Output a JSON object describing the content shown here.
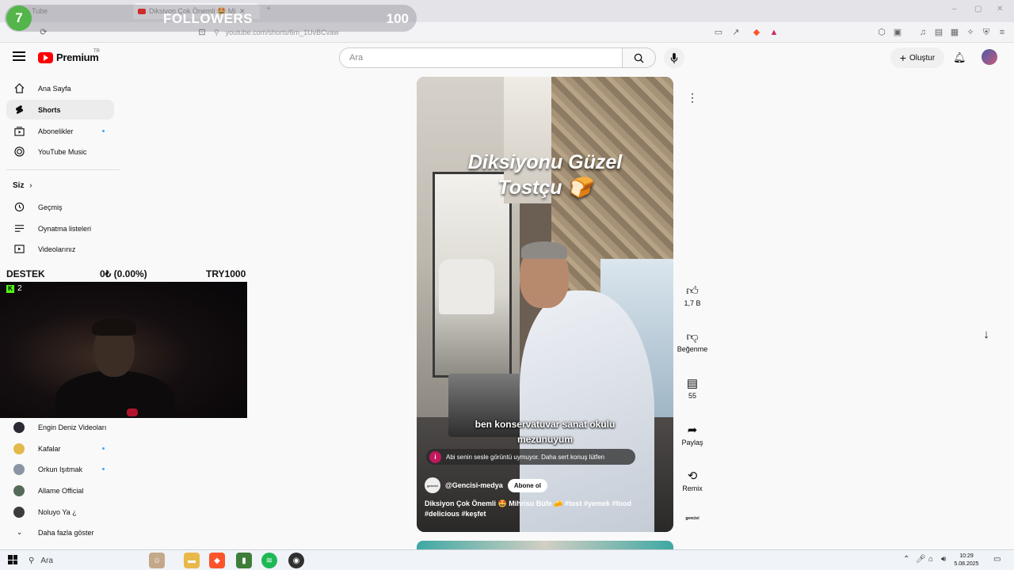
{
  "browser": {
    "tabs": [
      {
        "label": "Tube"
      },
      {
        "label": "Diksiyon Çok Önemli 🤩 Mihri"
      }
    ],
    "url": "youtube.com/shorts/6m_1UvBCvaw"
  },
  "overlay": {
    "follower_current": "7",
    "follower_label": "FOLLOWERS",
    "follower_goal": "100"
  },
  "header": {
    "brand": "Premium",
    "region": "TR",
    "search_placeholder": "Ara",
    "create_label": "Oluştur"
  },
  "sidebar": {
    "main": [
      {
        "label": "Ana Sayfa"
      },
      {
        "label": "Shorts"
      },
      {
        "label": "Abonelikler"
      },
      {
        "label": "YouTube Music"
      }
    ],
    "you_header": "Siz",
    "you": [
      {
        "label": "Geçmiş"
      },
      {
        "label": "Oynatma listeleri"
      },
      {
        "label": "Videolarınız"
      }
    ],
    "subscriptions": [
      {
        "label": "Engin Deniz Videoları"
      },
      {
        "label": "Kafalar"
      },
      {
        "label": "Orkun Işıtmak"
      },
      {
        "label": "Allame Official"
      },
      {
        "label": "Noluyo Ya ¿"
      }
    ],
    "show_more": "Daha fazla göster"
  },
  "donation": {
    "label": "DESTEK",
    "progress": "0₺ (0.00%)",
    "goal": "TRY1000",
    "viewers": "2"
  },
  "short": {
    "title_line1": "Diksiyonu Güzel",
    "title_line2": "Tostçu 🍞",
    "caption_line1": "ben konservatuvar sanat okulu",
    "caption_line2": "mezunuyum",
    "comment_badge": "i",
    "comment": "Abi senin sesle görüntü uymuyor. Daha sert konuş lütfen",
    "channel_logo": "gencisi",
    "channel": "@Gencisi-medya",
    "subscribe": "Abone ol",
    "description": "Diksiyon Çok Önemli 🤩 Mihrisu Büfe 🧀 #tost #yemek #food #delicious #keşfet"
  },
  "actions": {
    "likes": "1,7 B",
    "dislike": "Beğenme",
    "comments": "55",
    "share": "Paylaş",
    "remix": "Remix",
    "audio": "gencisi"
  },
  "taskbar": {
    "search": "Ara",
    "time": "10:29",
    "date": "5.08.2025"
  }
}
